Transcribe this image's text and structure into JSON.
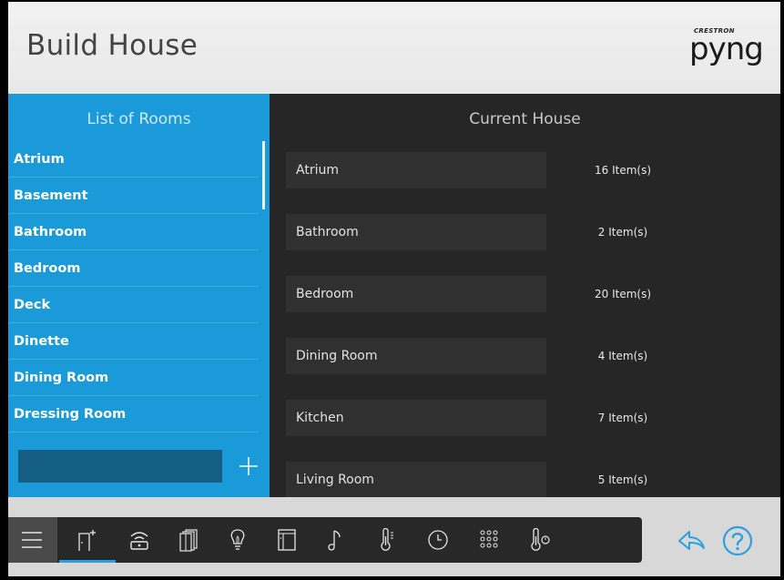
{
  "header": {
    "title": "Build House",
    "logo_brand": "CRESTRON",
    "logo_word": "pyng"
  },
  "rooms_panel": {
    "title": "List of Rooms",
    "items": [
      {
        "label": "Atrium"
      },
      {
        "label": "Basement"
      },
      {
        "label": "Bathroom"
      },
      {
        "label": "Bedroom"
      },
      {
        "label": "Deck"
      },
      {
        "label": "Dinette"
      },
      {
        "label": "Dining Room"
      },
      {
        "label": "Dressing Room"
      }
    ],
    "new_room_input": {
      "value": "",
      "placeholder": ""
    },
    "add_label": "+"
  },
  "house_panel": {
    "title": "Current House",
    "rooms": [
      {
        "name": "Atrium",
        "count": "16 Item(s)"
      },
      {
        "name": "Bathroom",
        "count": "2 Item(s)"
      },
      {
        "name": "Bedroom",
        "count": "20 Item(s)"
      },
      {
        "name": "Dining Room",
        "count": "4 Item(s)"
      },
      {
        "name": "Kitchen",
        "count": "7 Item(s)"
      },
      {
        "name": "Living Room",
        "count": "5 Item(s)"
      }
    ]
  },
  "toolbar": {
    "items": [
      {
        "icon": "menu-icon"
      },
      {
        "icon": "build-house-icon",
        "active": true
      },
      {
        "icon": "wireless-remote-icon"
      },
      {
        "icon": "shades-icon"
      },
      {
        "icon": "lightbulb-icon"
      },
      {
        "icon": "door-icon"
      },
      {
        "icon": "music-note-icon"
      },
      {
        "icon": "thermometer-icon"
      },
      {
        "icon": "clock-icon"
      },
      {
        "icon": "keypad-icon"
      },
      {
        "icon": "thermostat-icon"
      }
    ],
    "back_icon": "back-arrow-icon",
    "help_icon": "help-icon"
  },
  "colors": {
    "accent_blue": "#1a9ad8",
    "dark_panel": "#262626",
    "toolbar": "#282828",
    "highlight": "#2aa0e0"
  }
}
